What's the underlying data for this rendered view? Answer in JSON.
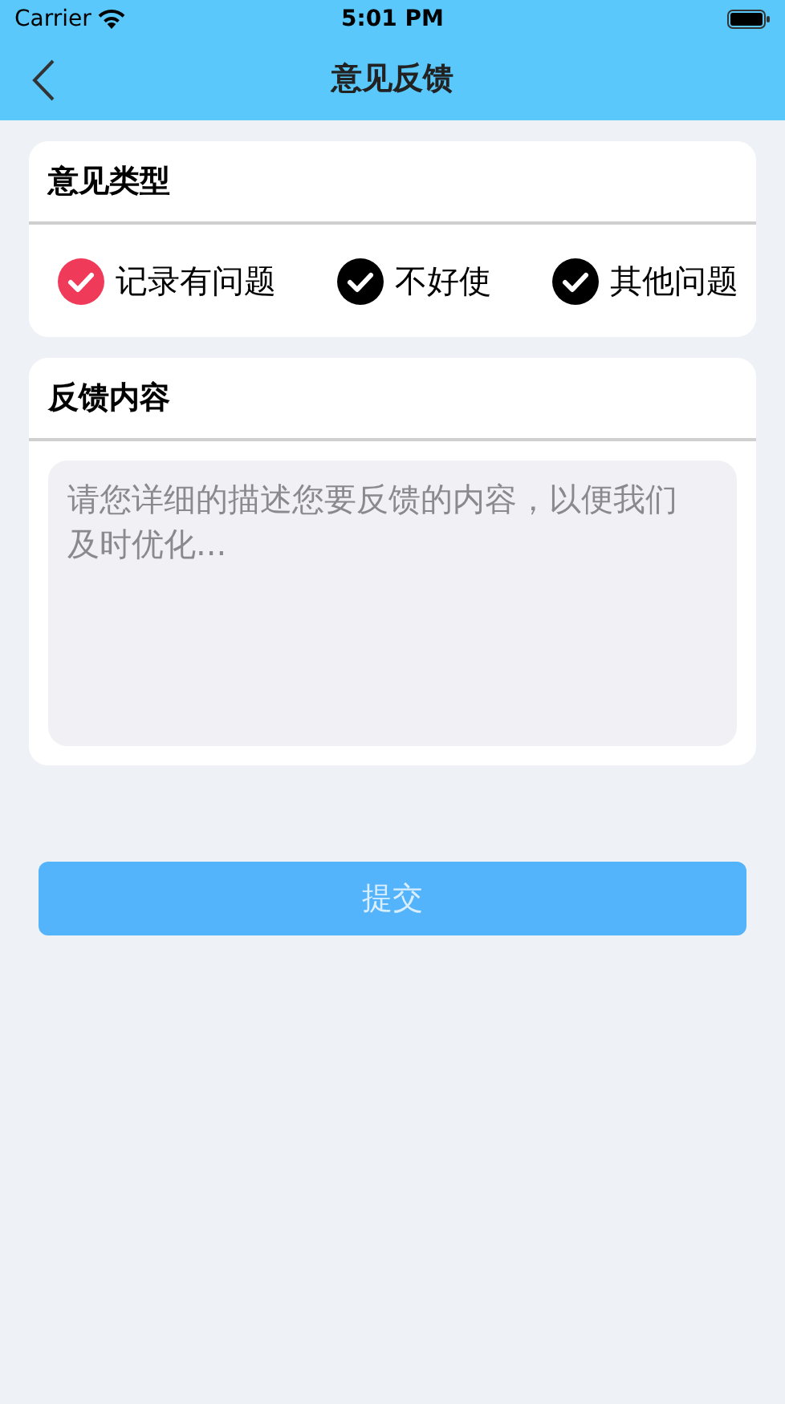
{
  "status_bar": {
    "carrier": "Carrier",
    "time": "5:01 PM"
  },
  "nav": {
    "title": "意见反馈"
  },
  "type_section": {
    "title": "意见类型",
    "options": [
      {
        "label": "记录有问题",
        "selected": true
      },
      {
        "label": "不好使",
        "selected": false
      },
      {
        "label": "其他问题",
        "selected": false
      }
    ]
  },
  "content_section": {
    "title": "反馈内容",
    "placeholder": "请您详细的描述您要反馈的内容，以便我们及时优化..."
  },
  "submit_button": {
    "label": "提交"
  }
}
